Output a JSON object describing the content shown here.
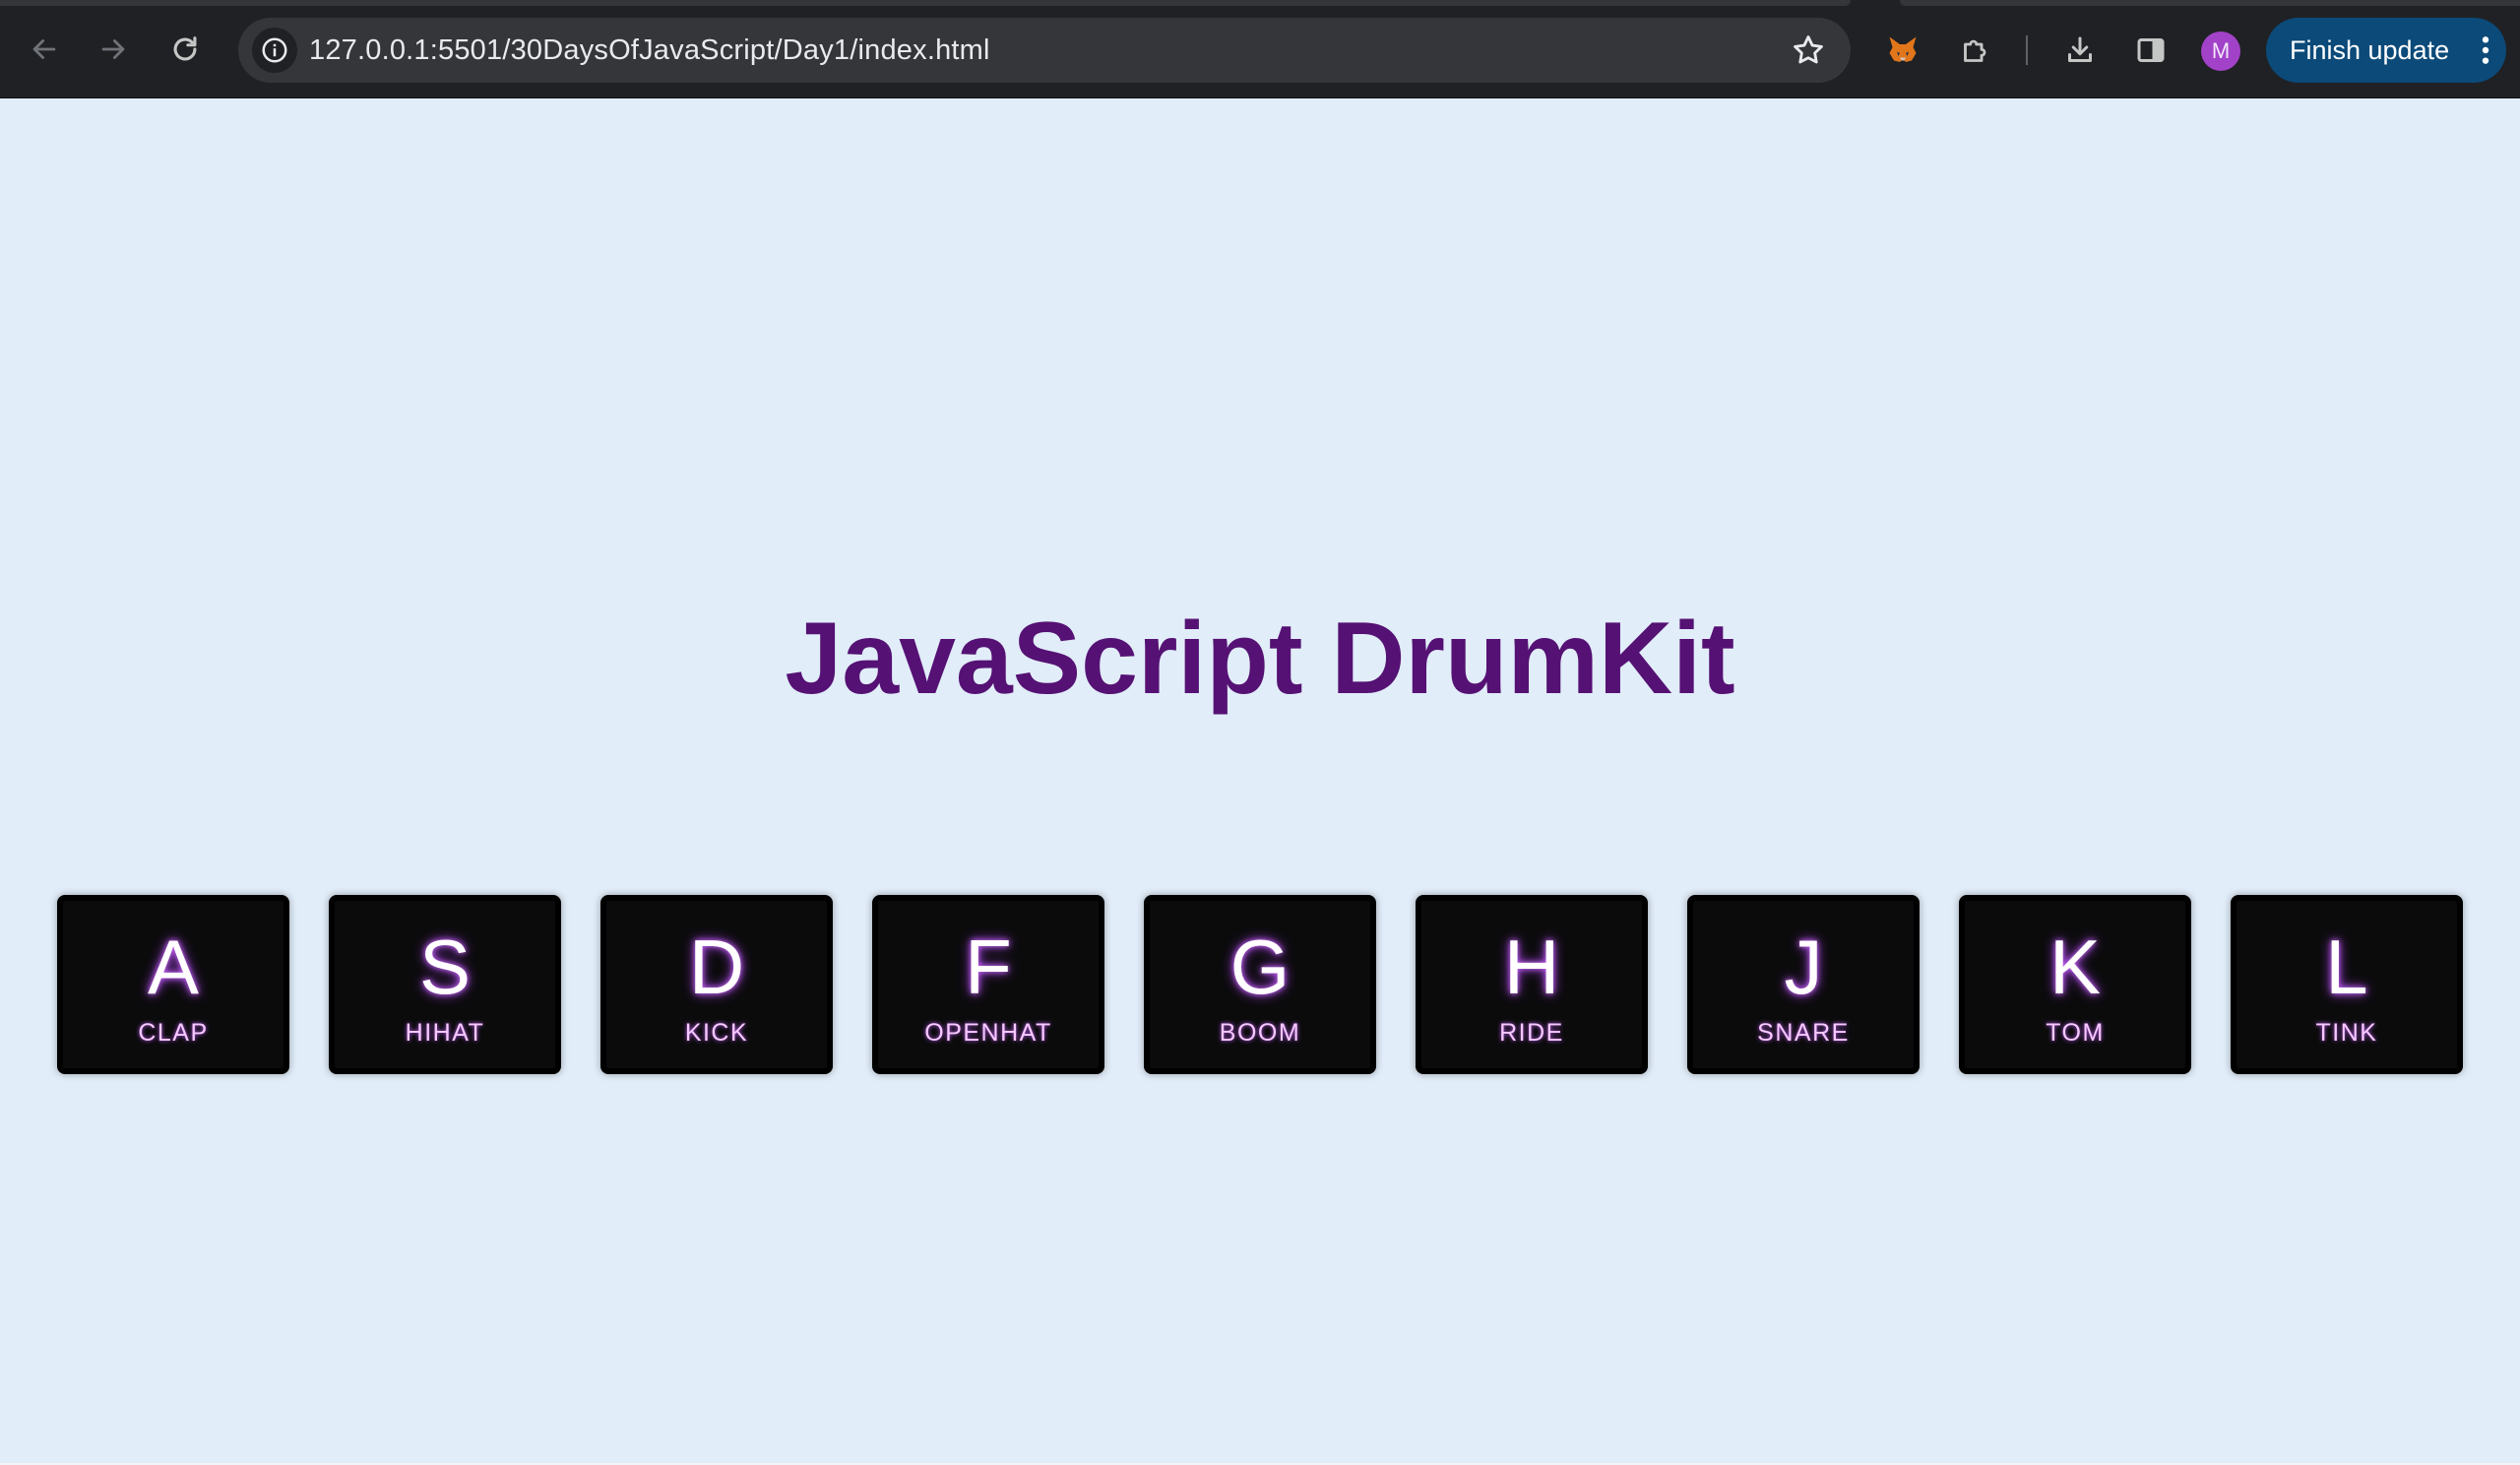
{
  "browser": {
    "url": "127.0.0.1:5501/30DaysOfJavaScript/Day1/index.html",
    "profile_initial": "M",
    "finish_update_label": "Finish update",
    "icons": {
      "back": "arrow-left-icon",
      "forward": "arrow-right-icon",
      "reload": "reload-icon",
      "site_info": "info-icon",
      "bookmark": "star-icon",
      "extension_metamask": "fox-icon",
      "extensions": "puzzle-icon",
      "downloads": "download-icon",
      "side_panel": "side-panel-icon",
      "menu": "kebab-icon"
    },
    "colors": {
      "toolbar": "#202124",
      "omnibox": "#35363a",
      "update_button": "#0b4a79",
      "avatar": "#a142c9"
    }
  },
  "page": {
    "title": "JavaScript DrumKit",
    "keys": [
      {
        "key": "A",
        "sound": "CLAP"
      },
      {
        "key": "S",
        "sound": "HIHAT"
      },
      {
        "key": "D",
        "sound": "KICK"
      },
      {
        "key": "F",
        "sound": "OPENHAT"
      },
      {
        "key": "G",
        "sound": "BOOM"
      },
      {
        "key": "H",
        "sound": "RIDE"
      },
      {
        "key": "J",
        "sound": "SNARE"
      },
      {
        "key": "K",
        "sound": "TOM"
      },
      {
        "key": "L",
        "sound": "TINK"
      }
    ],
    "colors": {
      "background": "#e1edf9",
      "title": "#551174",
      "key_background": "#0b0b0c",
      "key_glow": "#c45cff"
    }
  }
}
